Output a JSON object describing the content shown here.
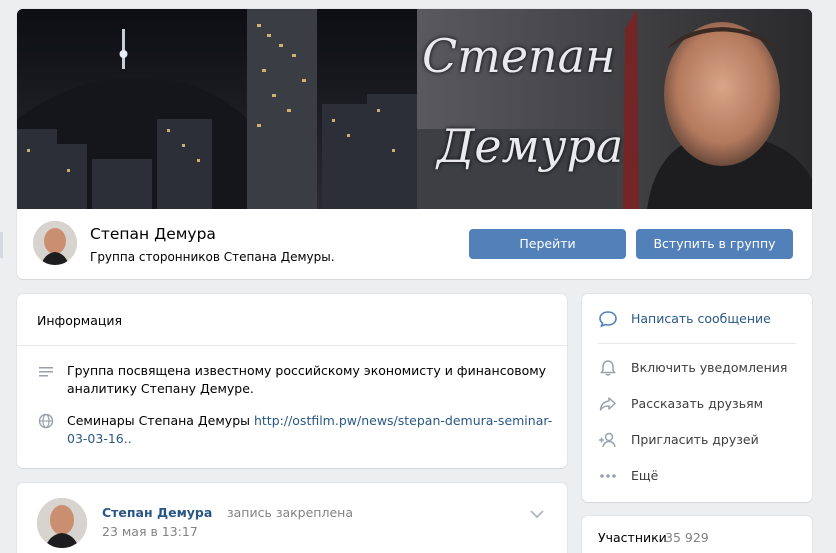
{
  "group": {
    "name": "Степан Демура",
    "status": "Группа сторонников Степана Демуры.",
    "cover_title_line1": "Степан",
    "cover_title_line2": "Демура"
  },
  "buttons": {
    "go": "Перейти",
    "join": "Вступить в группу"
  },
  "info": {
    "title": "Информация",
    "description": "Группа посвящена известному российскому экономисту и финансовому аналитику Степану Демуре.",
    "link_prefix": "Семинары Степана Демуры ",
    "link_text": "http://ostfilm.pw/news/stepan-demura-seminar-03-03-16.."
  },
  "post": {
    "author": "Степан Демура",
    "action": "запись закреплена",
    "date": "23 мая в 13:17"
  },
  "actions": {
    "items": [
      {
        "label": "Написать сообщение",
        "icon": "message-icon"
      },
      {
        "label": "Включить уведомления",
        "icon": "bell-icon"
      },
      {
        "label": "Рассказать друзьям",
        "icon": "share-icon"
      },
      {
        "label": "Пригласить друзей",
        "icon": "add-friend-icon"
      },
      {
        "label": "Ещё",
        "icon": "more-icon"
      }
    ]
  },
  "members": {
    "label": "Участники",
    "count": "35 929"
  },
  "colors": {
    "accent": "#5181b8",
    "link": "#2a5885",
    "background": "#edeef0"
  }
}
